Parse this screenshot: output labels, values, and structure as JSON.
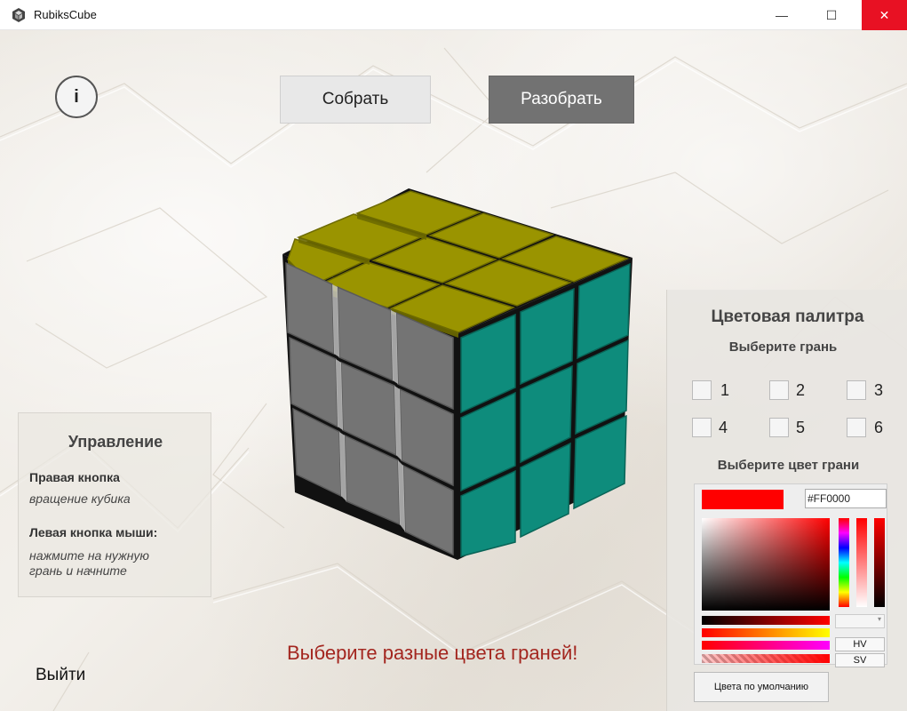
{
  "window": {
    "title": "RubiksCube",
    "minimize_glyph": "—",
    "maximize_glyph": "☐",
    "close_glyph": "✕"
  },
  "toolbar": {
    "info_label": "i",
    "solve_label": "Собрать",
    "shuffle_label": "Разобрать"
  },
  "controls": {
    "title": "Управление",
    "right_button_label": "Правая кнопка",
    "right_button_desc": "вращение кубика",
    "left_button_label": "Левая кнопка мыши:",
    "left_button_desc": "нажмите на нужную грань и начните"
  },
  "exit_label": "Выйти",
  "hint_text": "Выберите разные цвета граней!",
  "palette": {
    "title": "Цветовая палитра",
    "select_face_label": "Выберите грань",
    "faces": [
      "1",
      "2",
      "3",
      "4",
      "5",
      "6"
    ],
    "select_color_label": "Выберите цвет грани",
    "hex_value": "#FF0000",
    "mode_hv": "HV",
    "mode_sv": "SV",
    "default_colors_label": "Цвета по умолчанию"
  },
  "colors": {
    "cube_top": "#9a9400",
    "cube_left": "#747474",
    "cube_right": "#0e8c7c",
    "selected_color": "#FF0000",
    "hint_color": "#a3261f",
    "close_button": "#e81123"
  }
}
